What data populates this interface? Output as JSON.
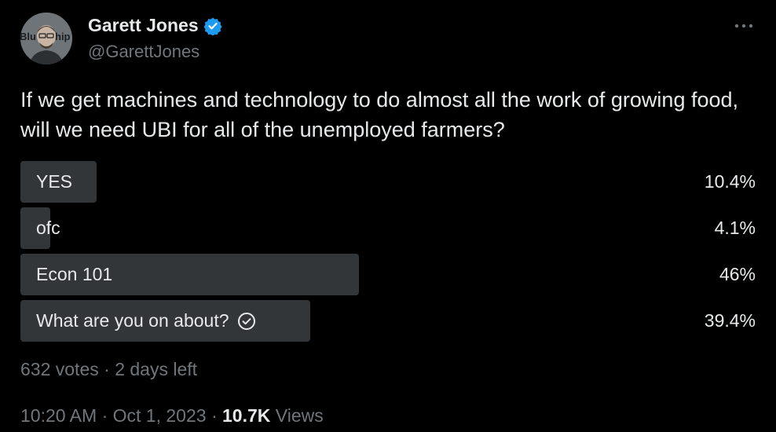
{
  "author": {
    "display_name": "Garett Jones",
    "handle": "@GarettJones",
    "avatar_icon": "avatar-photo",
    "verified_icon": "verified-badge-icon",
    "verified_color": "#1d9bf0"
  },
  "tweet": {
    "text": "If we get machines and technology to do almost all the work of growing food, will we need UBI for all of the unemployed farmers?"
  },
  "poll": {
    "options": [
      {
        "label": "YES",
        "percent_label": "10.4%",
        "percent": 10.4,
        "selected": false
      },
      {
        "label": "ofc",
        "percent_label": "4.1%",
        "percent": 4.1,
        "selected": false
      },
      {
        "label": "Econ 101",
        "percent_label": "46%",
        "percent": 46,
        "selected": false
      },
      {
        "label": "What are you on about?",
        "percent_label": "39.4%",
        "percent": 39.4,
        "selected": true
      }
    ],
    "votes": "632 votes",
    "separator": " · ",
    "time_left": "2 days left"
  },
  "meta": {
    "time": "10:20 AM",
    "separator": " · ",
    "date": "Oct 1, 2023",
    "views_count": "10.7K",
    "views_label": " Views"
  },
  "colors": {
    "background": "#000000",
    "text": "#e7e9ea",
    "muted": "#71767b",
    "bar": "#333639",
    "accent": "#1d9bf0"
  }
}
